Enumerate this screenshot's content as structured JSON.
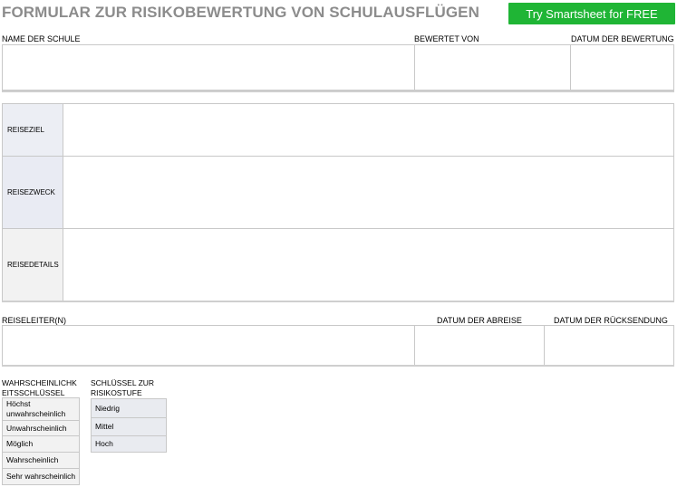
{
  "header": {
    "title": "FORMULAR ZUR RISIKOBEWERTUNG VON SCHULAUSFLÜGEN",
    "cta_label": "Try Smartsheet for FREE",
    "cta_color": "#1fb535"
  },
  "school_section": {
    "school_name_label": "NAME DER SCHULE",
    "evaluated_by_label": "BEWERTET VON",
    "evaluation_date_label": "DATUM DER BEWERTUNG"
  },
  "trip_section": {
    "destination_label": "REISEZIEL",
    "purpose_label": "REISEZWECK",
    "details_label": "REISEDETAILS"
  },
  "leader_section": {
    "leader_label": "REISELEITER(N)",
    "departure_date_label": "DATUM DER ABREISE",
    "return_date_label": "DATUM DER RÜCKSENDUNG"
  },
  "likelihood_key": {
    "heading": "WAHRSCHEINLICHKEITSSCHLÜSSEL",
    "items": [
      "Höchst unwahrscheinlich",
      "Unwahrscheinlich",
      "Möglich",
      "Wahrscheinlich",
      "Sehr wahrscheinlich"
    ]
  },
  "risk_key": {
    "heading": "SCHLÜSSEL ZUR RISIKOSTUFE",
    "items": [
      "Niedrig",
      "Mittel",
      "Hoch"
    ]
  }
}
